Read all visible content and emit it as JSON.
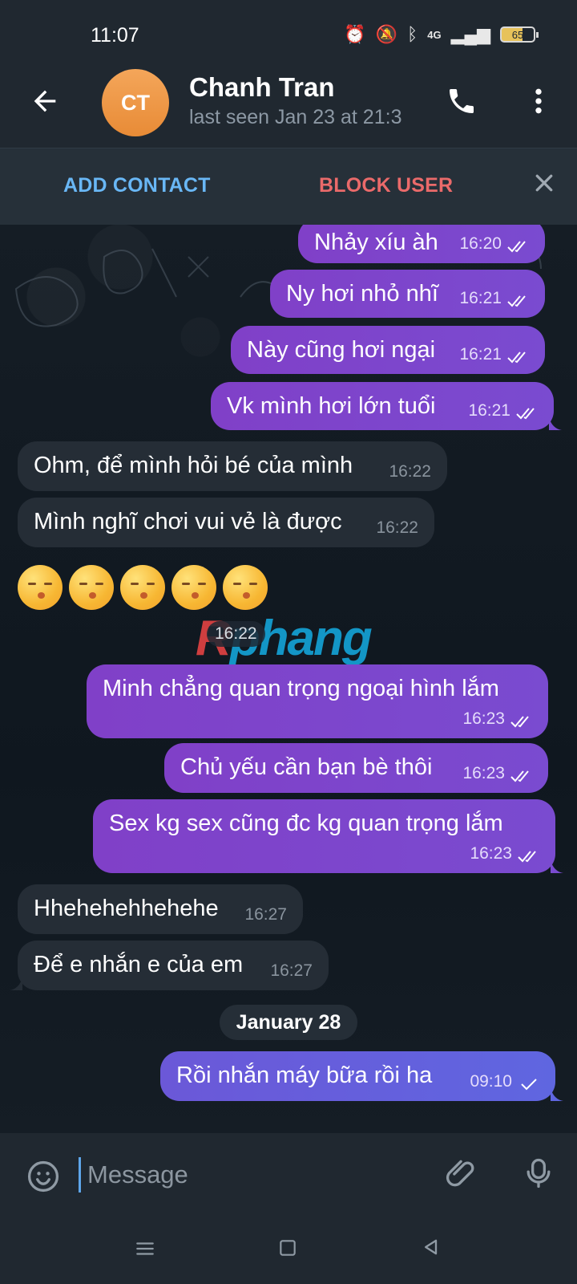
{
  "status": {
    "time": "11:07",
    "network": "4G",
    "battery": "65"
  },
  "header": {
    "avatar_initials": "CT",
    "name": "Chanh Tran",
    "status": "last seen Jan 23 at 21:3"
  },
  "actions": {
    "add_contact": "ADD CONTACT",
    "block_user": "BLOCK USER"
  },
  "messages": {
    "m1": {
      "text": "Nhảy xíu àh",
      "time": "16:20"
    },
    "m2": {
      "text": "Ny hơi nhỏ nhĩ",
      "time": "16:21"
    },
    "m3": {
      "text": "Này cũng hơi ngại",
      "time": "16:21"
    },
    "m4": {
      "text": "Vk mình hơi lớn tuổi",
      "time": "16:21"
    },
    "m5": {
      "text": "Ohm, để mình hỏi bé của mình",
      "time": "16:22"
    },
    "m6": {
      "text": "Mình nghĩ chơi vui vẻ là được",
      "time": "16:22"
    },
    "m7": {
      "text": "😚😚😚😚😚",
      "time": "16:22"
    },
    "m8": {
      "text": "Minh chẳng quan trọng ngoại hình lắm",
      "time": "16:23"
    },
    "m9": {
      "text": "Chủ yếu cần bạn bè thôi",
      "time": "16:23"
    },
    "m10": {
      "text": "Sex kg sex cũng đc kg quan trọng lắm",
      "time": "16:23"
    },
    "m11": {
      "text": "Hhehehehhehehe",
      "time": "16:27"
    },
    "m12": {
      "text": "Để e nhắn e của em",
      "time": "16:27"
    },
    "date": "January 28",
    "m13": {
      "text": "Rồi nhắn máy bữa rồi ha",
      "time": "09:10"
    }
  },
  "watermark": {
    "prefix": "R",
    "text": "phang"
  },
  "composer": {
    "placeholder": "Message"
  },
  "colors": {
    "outgoing": "#7d45cf",
    "incoming": "#252d36",
    "link": "#69b7f5",
    "danger": "#ea6a6a"
  },
  "icons": [
    "back-icon",
    "phone-icon",
    "more-vertical-icon",
    "close-icon",
    "double-check-icon",
    "single-check-icon",
    "emoji-icon",
    "attachment-icon",
    "microphone-icon",
    "menu-icon",
    "home-icon",
    "back-triangle-icon"
  ]
}
